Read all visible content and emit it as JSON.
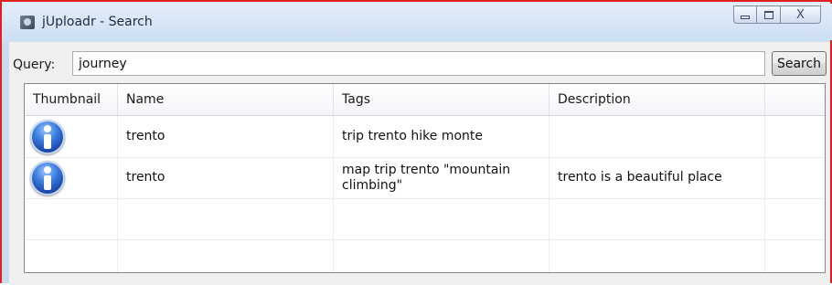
{
  "window": {
    "title": "jUploadr - Search",
    "controls": {
      "minimize": "minimize",
      "maximize": "maximize",
      "close": "X"
    }
  },
  "search": {
    "label": "Query:",
    "value": "journey",
    "button_label": "Search"
  },
  "table": {
    "columns": [
      "Thumbnail",
      "Name",
      "Tags",
      "Description"
    ],
    "rows": [
      {
        "thumbnail": "info-icon",
        "name": "trento",
        "tags": "trip trento hike monte",
        "description": ""
      },
      {
        "thumbnail": "info-icon",
        "name": "trento",
        "tags": "map trip trento \"mountain climbing\"",
        "description": "trento is a beautiful place"
      }
    ]
  },
  "colors": {
    "highlight_border": "#e02020",
    "title_bar": "#d8e6f6",
    "icon_blue": "#1f55c0"
  }
}
